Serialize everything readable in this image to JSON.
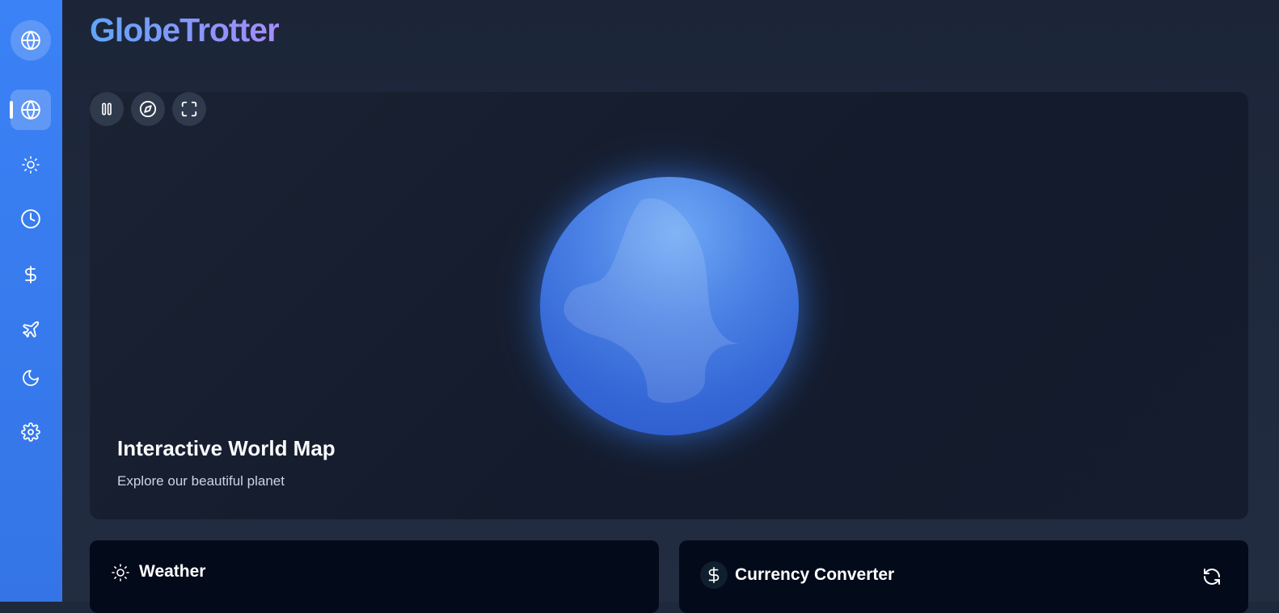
{
  "app": {
    "brand": "GlobeTrotter"
  },
  "sidebar": {
    "logo_icon": "globe-icon",
    "items": [
      {
        "icon": "globe-icon",
        "active": true
      },
      {
        "icon": "sun-icon"
      },
      {
        "icon": "clock-icon"
      },
      {
        "icon": "dollar-icon"
      },
      {
        "icon": "plane-icon"
      },
      {
        "icon": "moon-icon"
      },
      {
        "icon": "gear-icon"
      }
    ]
  },
  "map": {
    "title": "Interactive World Map",
    "subtitle": "Explore our beautiful planet",
    "controls": [
      "pause-icon",
      "compass-icon",
      "fullscreen-icon"
    ]
  },
  "weather": {
    "title": "Weather",
    "icon": "sun-icon"
  },
  "currency": {
    "title": "Currency Converter",
    "icon": "dollar-icon",
    "refresh_icon": "refresh-icon"
  },
  "colors": {
    "accent": "#3b82f6",
    "brand_gradient_start": "#60a5fa",
    "brand_gradient_end": "#a78bfa",
    "background": "#1e293b"
  }
}
